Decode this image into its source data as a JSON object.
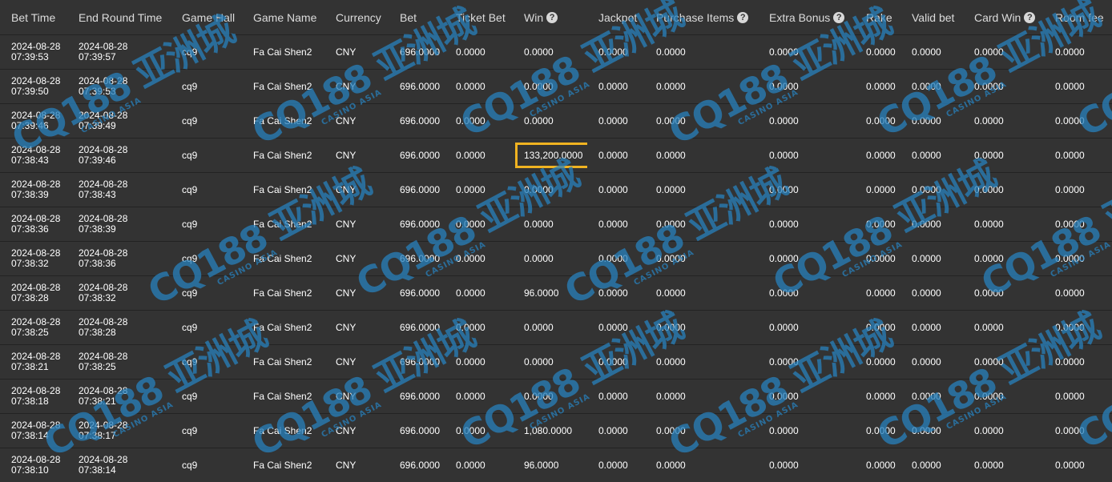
{
  "columns": [
    {
      "label": "Bet Time",
      "help": false
    },
    {
      "label": "End Round Time",
      "help": false
    },
    {
      "label": "Game Hall",
      "help": false
    },
    {
      "label": "Game Name",
      "help": false
    },
    {
      "label": "Currency",
      "help": false
    },
    {
      "label": "Bet",
      "help": false
    },
    {
      "label": "Ticket Bet",
      "help": false
    },
    {
      "label": "Win",
      "help": true
    },
    {
      "label": "Jackpot",
      "help": false
    },
    {
      "label": "Purchase Items",
      "help": true
    },
    {
      "label": "Extra Bonus",
      "help": true
    },
    {
      "label": "Rake",
      "help": false
    },
    {
      "label": "Valid bet",
      "help": false
    },
    {
      "label": "Card Win",
      "help": true
    },
    {
      "label": "Room fee",
      "help": false
    }
  ],
  "help_glyph": "?",
  "watermark": {
    "main": "CQ188 亚洲城",
    "sub": "CASINO ASIA"
  },
  "highlight_color": "#f0b321",
  "rows": [
    {
      "bet_date": "2024-08-28",
      "bet_time": "07:39:53",
      "end_date": "2024-08-28",
      "end_time": "07:39:57",
      "hall": "cq9",
      "game": "Fa Cai Shen2",
      "currency": "CNY",
      "bet": "696.0000",
      "ticket_bet": "0.0000",
      "win": "0.0000",
      "jackpot": "0.0000",
      "purchase": "0.0000",
      "extra_bonus": "0.0000",
      "rake": "0.0000",
      "valid_bet": "0.0000",
      "card_win": "0.0000",
      "room_fee": "0.0000"
    },
    {
      "bet_date": "2024-08-28",
      "bet_time": "07:39:50",
      "end_date": "2024-08-28",
      "end_time": "07:39:53",
      "hall": "cq9",
      "game": "Fa Cai Shen2",
      "currency": "CNY",
      "bet": "696.0000",
      "ticket_bet": "0.0000",
      "win": "0.0000",
      "jackpot": "0.0000",
      "purchase": "0.0000",
      "extra_bonus": "0.0000",
      "rake": "0.0000",
      "valid_bet": "0.0000",
      "card_win": "0.0000",
      "room_fee": "0.0000"
    },
    {
      "bet_date": "2024-08-28",
      "bet_time": "07:39:46",
      "end_date": "2024-08-28",
      "end_time": "07:39:49",
      "hall": "cq9",
      "game": "Fa Cai Shen2",
      "currency": "CNY",
      "bet": "696.0000",
      "ticket_bet": "0.0000",
      "win": "0.0000",
      "jackpot": "0.0000",
      "purchase": "0.0000",
      "extra_bonus": "0.0000",
      "rake": "0.0000",
      "valid_bet": "0.0000",
      "card_win": "0.0000",
      "room_fee": "0.0000"
    },
    {
      "bet_date": "2024-08-28",
      "bet_time": "07:38:43",
      "end_date": "2024-08-28",
      "end_time": "07:39:46",
      "hall": "cq9",
      "game": "Fa Cai Shen2",
      "currency": "CNY",
      "bet": "696.0000",
      "ticket_bet": "0.0000",
      "win": "133,200.0000",
      "win_highlight": true,
      "jackpot": "0.0000",
      "purchase": "0.0000",
      "extra_bonus": "0.0000",
      "rake": "0.0000",
      "valid_bet": "0.0000",
      "card_win": "0.0000",
      "room_fee": "0.0000"
    },
    {
      "bet_date": "2024-08-28",
      "bet_time": "07:38:39",
      "end_date": "2024-08-28",
      "end_time": "07:38:43",
      "hall": "cq9",
      "game": "Fa Cai Shen2",
      "currency": "CNY",
      "bet": "696.0000",
      "ticket_bet": "0.0000",
      "win": "0.0000",
      "jackpot": "0.0000",
      "purchase": "0.0000",
      "extra_bonus": "0.0000",
      "rake": "0.0000",
      "valid_bet": "0.0000",
      "card_win": "0.0000",
      "room_fee": "0.0000"
    },
    {
      "bet_date": "2024-08-28",
      "bet_time": "07:38:36",
      "end_date": "2024-08-28",
      "end_time": "07:38:39",
      "hall": "cq9",
      "game": "Fa Cai Shen2",
      "currency": "CNY",
      "bet": "696.0000",
      "ticket_bet": "0.0000",
      "win": "0.0000",
      "jackpot": "0.0000",
      "purchase": "0.0000",
      "extra_bonus": "0.0000",
      "rake": "0.0000",
      "valid_bet": "0.0000",
      "card_win": "0.0000",
      "room_fee": "0.0000"
    },
    {
      "bet_date": "2024-08-28",
      "bet_time": "07:38:32",
      "end_date": "2024-08-28",
      "end_time": "07:38:36",
      "hall": "cq9",
      "game": "Fa Cai Shen2",
      "currency": "CNY",
      "bet": "696.0000",
      "ticket_bet": "0.0000",
      "win": "0.0000",
      "jackpot": "0.0000",
      "purchase": "0.0000",
      "extra_bonus": "0.0000",
      "rake": "0.0000",
      "valid_bet": "0.0000",
      "card_win": "0.0000",
      "room_fee": "0.0000"
    },
    {
      "bet_date": "2024-08-28",
      "bet_time": "07:38:28",
      "end_date": "2024-08-28",
      "end_time": "07:38:32",
      "hall": "cq9",
      "game": "Fa Cai Shen2",
      "currency": "CNY",
      "bet": "696.0000",
      "ticket_bet": "0.0000",
      "win": "96.0000",
      "jackpot": "0.0000",
      "purchase": "0.0000",
      "extra_bonus": "0.0000",
      "rake": "0.0000",
      "valid_bet": "0.0000",
      "card_win": "0.0000",
      "room_fee": "0.0000"
    },
    {
      "bet_date": "2024-08-28",
      "bet_time": "07:38:25",
      "end_date": "2024-08-28",
      "end_time": "07:38:28",
      "hall": "cq9",
      "game": "Fa Cai Shen2",
      "currency": "CNY",
      "bet": "696.0000",
      "ticket_bet": "0.0000",
      "win": "0.0000",
      "jackpot": "0.0000",
      "purchase": "0.0000",
      "extra_bonus": "0.0000",
      "rake": "0.0000",
      "valid_bet": "0.0000",
      "card_win": "0.0000",
      "room_fee": "0.0000"
    },
    {
      "bet_date": "2024-08-28",
      "bet_time": "07:38:21",
      "end_date": "2024-08-28",
      "end_time": "07:38:25",
      "hall": "cq9",
      "game": "Fa Cai Shen2",
      "currency": "CNY",
      "bet": "696.0000",
      "ticket_bet": "0.0000",
      "win": "0.0000",
      "jackpot": "0.0000",
      "purchase": "0.0000",
      "extra_bonus": "0.0000",
      "rake": "0.0000",
      "valid_bet": "0.0000",
      "card_win": "0.0000",
      "room_fee": "0.0000"
    },
    {
      "bet_date": "2024-08-28",
      "bet_time": "07:38:18",
      "end_date": "2024-08-28",
      "end_time": "07:38:21",
      "hall": "cq9",
      "game": "Fa Cai Shen2",
      "currency": "CNY",
      "bet": "696.0000",
      "ticket_bet": "0.0000",
      "win": "0.0000",
      "jackpot": "0.0000",
      "purchase": "0.0000",
      "extra_bonus": "0.0000",
      "rake": "0.0000",
      "valid_bet": "0.0000",
      "card_win": "0.0000",
      "room_fee": "0.0000"
    },
    {
      "bet_date": "2024-08-28",
      "bet_time": "07:38:14",
      "end_date": "2024-08-28",
      "end_time": "07:38:17",
      "hall": "cq9",
      "game": "Fa Cai Shen2",
      "currency": "CNY",
      "bet": "696.0000",
      "ticket_bet": "0.0000",
      "win": "1,080.0000",
      "jackpot": "0.0000",
      "purchase": "0.0000",
      "extra_bonus": "0.0000",
      "rake": "0.0000",
      "valid_bet": "0.0000",
      "card_win": "0.0000",
      "room_fee": "0.0000"
    },
    {
      "bet_date": "2024-08-28",
      "bet_time": "07:38:10",
      "end_date": "2024-08-28",
      "end_time": "07:38:14",
      "hall": "cq9",
      "game": "Fa Cai Shen2",
      "currency": "CNY",
      "bet": "696.0000",
      "ticket_bet": "0.0000",
      "win": "96.0000",
      "jackpot": "0.0000",
      "purchase": "0.0000",
      "extra_bonus": "0.0000",
      "rake": "0.0000",
      "valid_bet": "0.0000",
      "card_win": "0.0000",
      "room_fee": "0.0000"
    }
  ]
}
